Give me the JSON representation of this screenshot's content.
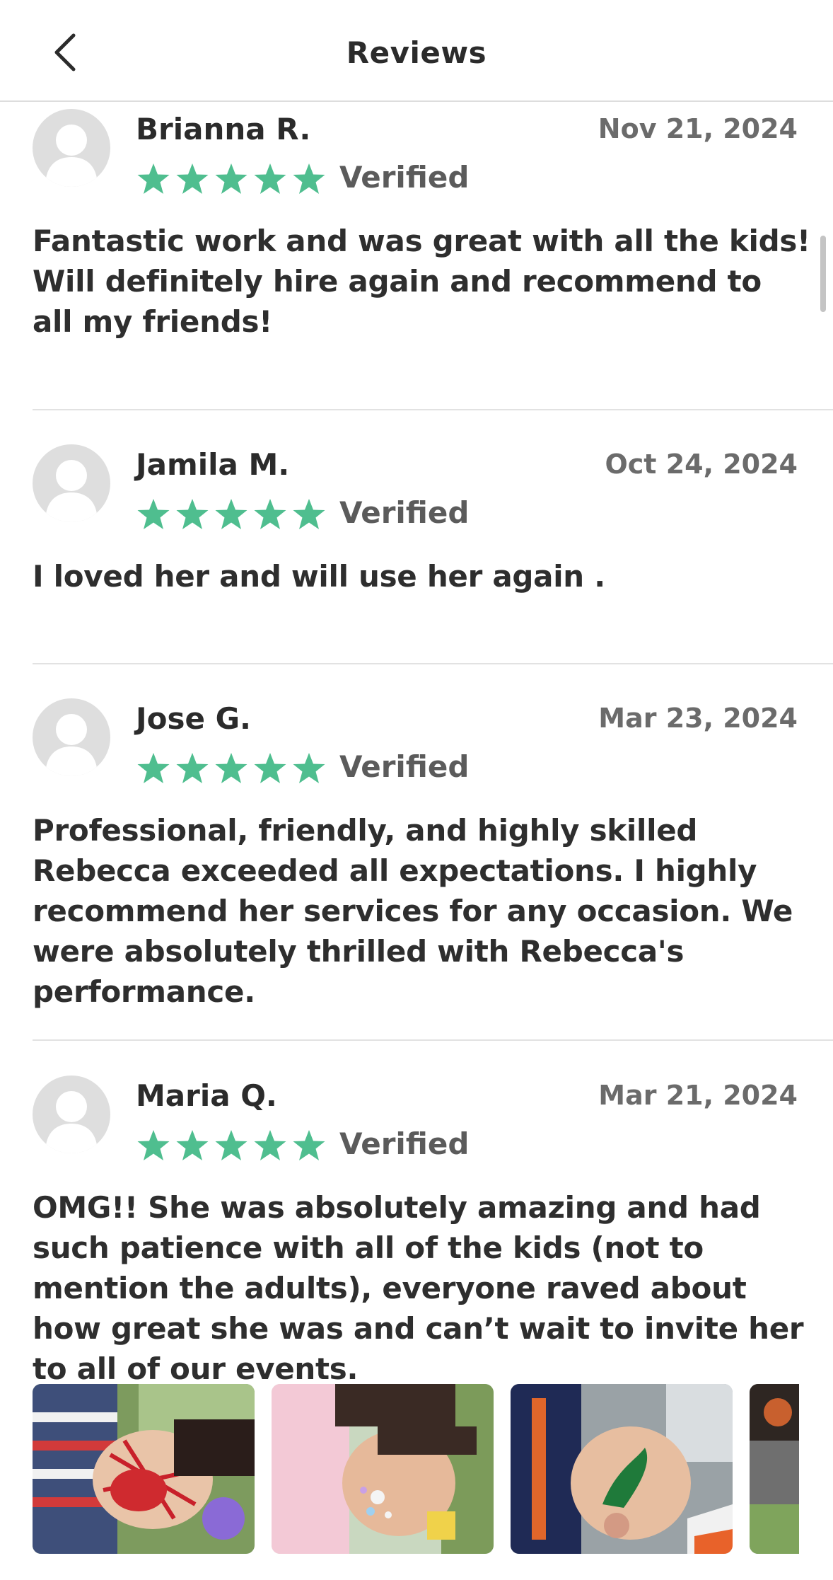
{
  "header": {
    "title": "Reviews",
    "back_icon": "chevron-left-icon"
  },
  "colors": {
    "star": "#4fbe8f",
    "verified": "#5b5b5b",
    "date": "#6b6b6b",
    "divider": "#e2e2e2"
  },
  "reviews": [
    {
      "name": "Brianna R.",
      "date": "Nov 21, 2024",
      "rating": 5,
      "verified": "Verified",
      "text": "Fantastic work and was great with all the kids! Will definitely hire again and recommend to all my friends!"
    },
    {
      "name": "Jamila M.",
      "date": "Oct 24, 2024",
      "rating": 5,
      "verified": "Verified",
      "text": "I loved her and will use her again ."
    },
    {
      "name": "Jose G.",
      "date": "Mar 23, 2024",
      "rating": 5,
      "verified": "Verified",
      "text": "Professional, friendly, and highly skilled Rebecca exceeded all expectations. I highly recommend her services for any occasion. We were absolutely thrilled with Rebecca's performance."
    },
    {
      "name": "Maria Q.",
      "date": "Mar 21, 2024",
      "rating": 5,
      "verified": "Verified",
      "text": "OMG!! She was absolutely amazing and had such patience with all of the kids (not to mention the adults), everyone raved about how great she was and can’t wait to invite her to all of our events."
    }
  ],
  "photos": [
    {
      "icon": "photo-spiderman-face-paint"
    },
    {
      "icon": "photo-sparkle-face-paint"
    },
    {
      "icon": "photo-dinosaur-face-paint"
    },
    {
      "icon": "photo-partial"
    }
  ]
}
